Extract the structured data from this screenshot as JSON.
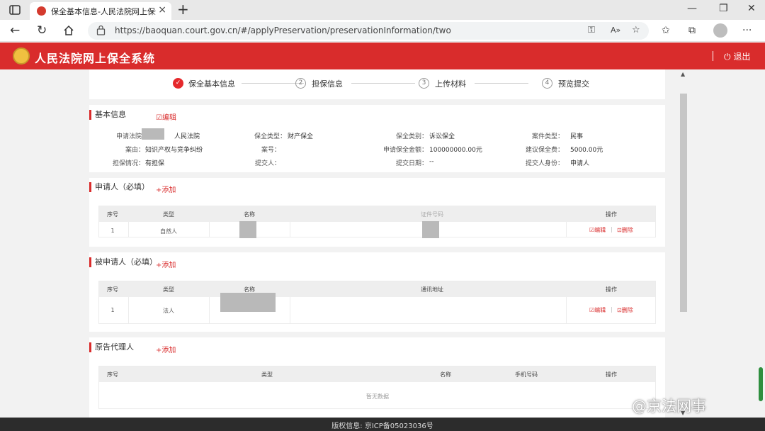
{
  "browser": {
    "tab_title": "保全基本信息-人民法院网上保全",
    "url": "https://baoquan.court.gov.cn/#/applyPreservation/preservationInformation/two"
  },
  "header": {
    "site_title": "人民法院网上保全系统",
    "logout_label": "退出"
  },
  "steps": [
    {
      "label": "保全基本信息",
      "number": "✓",
      "status": "done"
    },
    {
      "label": "担保信息",
      "number": "2",
      "status": "pending"
    },
    {
      "label": "上传材料",
      "number": "3",
      "status": "pending"
    },
    {
      "label": "预览提交",
      "number": "4",
      "status": "pending"
    }
  ],
  "basic_info": {
    "title": "基本信息",
    "edit_label": "编辑",
    "fields": {
      "court_label": "申请法院：",
      "court_value": "人民法院",
      "type_label": "保全类型：",
      "type_value": "财产保全",
      "category_label": "保全类别：",
      "category_value": "诉讼保全",
      "case_type_label": "案件类型：",
      "case_type_value": "民事",
      "cause_label": "案由：",
      "cause_value": "知识产权与竞争纠纷",
      "case_no_label": "案号：",
      "case_no_value": "",
      "amount_label": "申请保全金额：",
      "amount_value": "100000000.00元",
      "fee_label": "建议保全费：",
      "fee_value": "5000.00元",
      "guarantee_label": "担保情况：",
      "guarantee_value": "有担保",
      "submitter_label": "提交人：",
      "submitter_value": "",
      "submit_date_label": "提交日期：",
      "submit_date_value": "--",
      "identity_label": "提交人身份：",
      "identity_value": "申请人"
    }
  },
  "applicant": {
    "title": "申请人（必填）",
    "add_label": "添加",
    "headers": [
      "序号",
      "类型",
      "名称",
      "证件号码",
      "操作"
    ],
    "rows": [
      {
        "index": "1",
        "type": "自然人",
        "edit": "编辑",
        "delete": "删除"
      }
    ]
  },
  "respondent": {
    "title": "被申请人（必填）",
    "add_label": "添加",
    "headers": [
      "序号",
      "类型",
      "名称",
      "通讯地址",
      "操作"
    ],
    "rows": [
      {
        "index": "1",
        "type": "法人",
        "edit": "编辑",
        "delete": "删除"
      }
    ]
  },
  "agent": {
    "title": "原告代理人",
    "add_label": "添加",
    "headers": [
      "序号",
      "类型",
      "名称",
      "手机号码",
      "操作"
    ],
    "empty_text": "暂无数据"
  },
  "footer": {
    "text": "版权信息: 京ICP备05023036号"
  },
  "watermark": "@京法网事",
  "colors": {
    "brand_red": "#d92c2c",
    "footer_bg": "#2c2c2c"
  }
}
